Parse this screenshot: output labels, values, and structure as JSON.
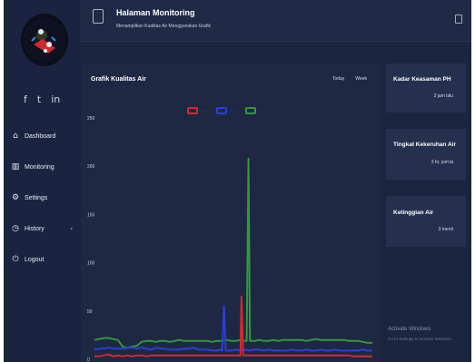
{
  "header": {
    "title": "Halaman Monitoring",
    "subtitle": "Menampilkan Kualitas Air Menggunakan Grafik"
  },
  "sidebar": {
    "socials": [
      "f",
      "t",
      "in"
    ],
    "menu": [
      {
        "label": "Dashboard",
        "icon": "dashboard-icon",
        "glyph": "⌂"
      },
      {
        "label": "Monitoring",
        "icon": "monitoring-icon",
        "glyph": "▥"
      },
      {
        "label": "Settings",
        "icon": "settings-icon",
        "glyph": "⚙"
      },
      {
        "label": "History",
        "icon": "history-icon",
        "glyph": "◷"
      },
      {
        "label": "Logout",
        "icon": "logout-icon",
        "glyph": "⏻"
      }
    ],
    "history_caret": "‹"
  },
  "chart": {
    "title": "Grafik Kualitas Air",
    "range_tabs": [
      "Today",
      "Week"
    ],
    "legend_colors": [
      "#d42a2a",
      "#2b3ed6",
      "#2f9a3c"
    ],
    "line_color": "#202d4c"
  },
  "chart_data": {
    "type": "line",
    "ylim": [
      0,
      250
    ],
    "yticks": [
      0,
      50,
      100,
      150,
      200,
      250
    ],
    "ytick_labels": [
      "0",
      "50",
      "100",
      "150",
      "200",
      "250"
    ],
    "x_count": 60,
    "series": [
      {
        "color": "#2f9a3c",
        "values": [
          20,
          21,
          22,
          22,
          21,
          20,
          13,
          12,
          13,
          14,
          18,
          19,
          19,
          18,
          19,
          19,
          18,
          19,
          20,
          19,
          19,
          19,
          19,
          19,
          19,
          18,
          19,
          19,
          20,
          19,
          19,
          20,
          19,
          19,
          19,
          20,
          19,
          19,
          20,
          19,
          20,
          20,
          20,
          20,
          20,
          19,
          20,
          21,
          20,
          20,
          20,
          20,
          20,
          20,
          19,
          19,
          19,
          18,
          17,
          17
        ]
      },
      {
        "color": "#2b3ed6",
        "values": [
          10,
          11,
          11,
          12,
          11,
          11,
          11,
          12,
          12,
          11,
          12,
          11,
          10,
          12,
          11,
          11,
          10,
          10,
          10,
          11,
          11,
          12,
          10,
          10,
          10,
          9,
          9,
          10,
          9,
          9,
          10,
          9,
          10,
          9,
          10,
          10,
          9,
          10,
          9,
          9,
          9,
          9,
          10,
          9,
          9,
          10,
          9,
          9,
          10,
          9,
          9,
          10,
          9,
          9,
          9,
          9,
          9,
          10,
          9,
          9
        ]
      },
      {
        "color": "#d42a2a",
        "values": [
          3,
          3,
          4,
          5,
          3,
          4,
          3,
          4,
          3,
          4,
          4,
          3,
          4,
          4,
          4,
          4,
          4,
          4,
          4,
          4,
          4,
          4,
          4,
          4,
          4,
          4,
          4,
          4,
          4,
          4,
          4,
          4,
          4,
          4,
          4,
          4,
          4,
          4,
          4,
          4,
          4,
          4,
          4,
          4,
          4,
          4,
          4,
          4,
          4,
          4,
          4,
          4,
          4,
          4,
          4,
          3,
          3,
          3,
          3,
          3
        ]
      }
    ],
    "spikes": [
      {
        "series": 0,
        "x": 32.7,
        "peak": 208
      },
      {
        "series": 1,
        "x": 27.5,
        "peak": 55
      },
      {
        "series": 2,
        "x": 31.2,
        "peak": 65
      }
    ]
  },
  "cards": [
    {
      "title": "Kadar Keasaman PH",
      "value": "3 jam lalu"
    },
    {
      "title": "Tingkat Kekeruhan Air",
      "value": "3 hr, jum'at"
    },
    {
      "title": "Ketinggian Air",
      "value": "3 menit"
    }
  ],
  "watermark": {
    "title": "Activate Windows",
    "subtitle": "Go to Settings to activate Windows."
  }
}
